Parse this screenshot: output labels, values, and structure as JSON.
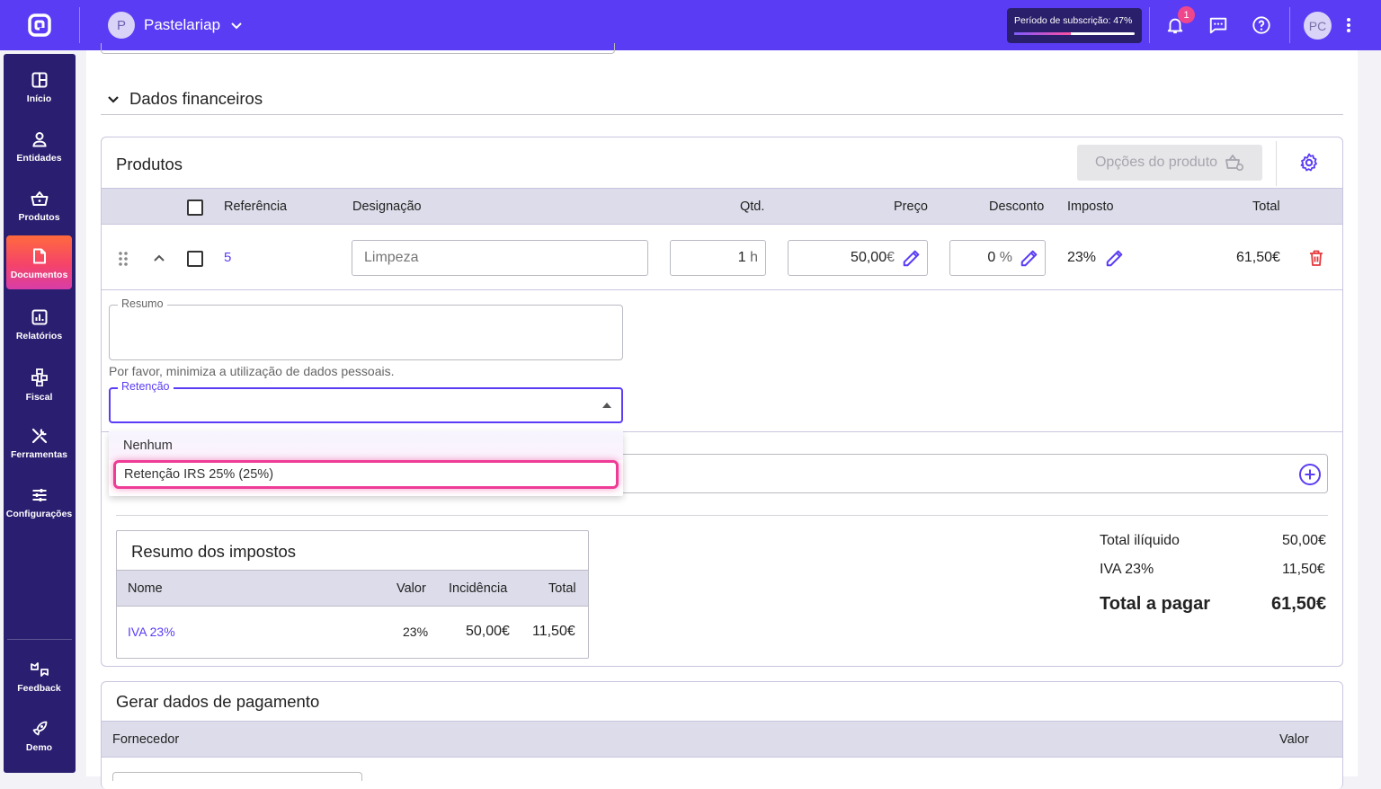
{
  "topbar": {
    "company_initial": "P",
    "company_name": "Pastelariap",
    "subscription_label": "Período de subscrição: 47%",
    "subscription_progress": 0.47,
    "notification_count": "1",
    "user_initials": "PC",
    "accent_color": "#5b3cf5"
  },
  "sidebar": {
    "items": [
      {
        "label": "Início",
        "icon": "grid-icon"
      },
      {
        "label": "Entidades",
        "icon": "person-icon"
      },
      {
        "label": "Produtos",
        "icon": "basket-icon"
      },
      {
        "label": "Documentos",
        "icon": "document-icon",
        "active": true
      },
      {
        "label": "Relatórios",
        "icon": "chart-icon"
      },
      {
        "label": "Fiscal",
        "icon": "hierarchy-icon"
      },
      {
        "label": "Ferramentas",
        "icon": "tools-icon"
      },
      {
        "label": "Configurações",
        "icon": "sliders-icon"
      },
      {
        "label": "Feedback",
        "icon": "feedback-icon"
      },
      {
        "label": "Demo",
        "icon": "rocket-icon"
      }
    ]
  },
  "section": {
    "title": "Dados financeiros"
  },
  "products": {
    "title": "Produtos",
    "options_button": "Opções do produto",
    "columns": {
      "reference": "Referência",
      "designation": "Designação",
      "qty": "Qtd.",
      "price": "Preço",
      "discount": "Desconto",
      "tax": "Imposto",
      "total": "Total"
    },
    "row": {
      "reference": "5",
      "designation_placeholder": "Limpeza",
      "qty": "1",
      "qty_unit": "h",
      "price": "50,00",
      "currency": "€",
      "discount": "0",
      "discount_unit": "%",
      "tax": "23%",
      "total": "61,50€"
    },
    "summary_label": "Resumo",
    "helper_text": "Por favor, minimiza a utilização de dados pessoais.",
    "retention_label": "Retenção",
    "retention_options": [
      "Nenhum",
      "Retenção IRS 25% (25%)"
    ]
  },
  "tax_summary": {
    "title": "Resumo dos impostos",
    "columns": {
      "name": "Nome",
      "value": "Valor",
      "incidence": "Incidência",
      "total": "Total"
    },
    "rows": [
      {
        "name": "IVA 23%",
        "value": "23%",
        "incidence": "50,00€",
        "total": "11,50€"
      }
    ]
  },
  "totals": {
    "net_label": "Total ilíquido",
    "net_value": "50,00€",
    "vat_label": "IVA 23%",
    "vat_value": "11,50€",
    "pay_label": "Total a pagar",
    "pay_value": "61,50€"
  },
  "payment": {
    "title": "Gerar dados de pagamento",
    "col_supplier": "Fornecedor",
    "col_value": "Valor"
  }
}
